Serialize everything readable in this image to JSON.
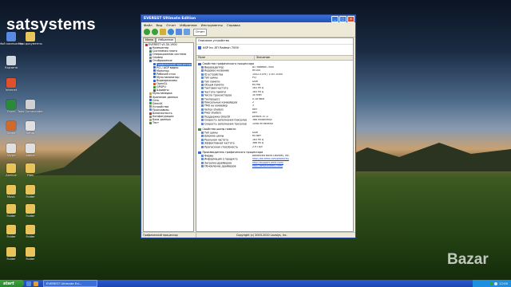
{
  "desktop": {
    "brand": "satsystems",
    "watermark": "Bazar",
    "icons": [
      {
        "label": "Мой компьютер",
        "color": "#5a8ae0"
      },
      {
        "label": "Мои документы",
        "color": "#e8c45a"
      },
      {
        "label": "Корзина",
        "color": "#cfd8e0"
      },
      {
        "label": "Internet",
        "color": "#e0502a"
      },
      {
        "label": "Excel",
        "color": "#2a8a3a"
      },
      {
        "label": "Total Commander",
        "color": "#d0d0d0"
      },
      {
        "label": "Game",
        "color": "#d06a2a"
      },
      {
        "label": "Setup",
        "color": "#e0e0e0"
      },
      {
        "label": "Skype",
        "color": "#e0e0e0"
      },
      {
        "label": "Adobe",
        "color": "#e0e0e0"
      },
      {
        "label": "Archive",
        "color": "#e8c45a"
      },
      {
        "label": "Files",
        "color": "#e8c45a"
      },
      {
        "label": "Music",
        "color": "#e8c45a"
      },
      {
        "label": "Folder",
        "color": "#e8c45a"
      },
      {
        "label": "Folder",
        "color": "#e8c45a"
      },
      {
        "label": "Folder",
        "color": "#e8c45a"
      },
      {
        "label": "Folder",
        "color": "#e8c45a"
      },
      {
        "label": "Folder",
        "color": "#e8c45a"
      },
      {
        "label": "Folder",
        "color": "#e8c45a"
      },
      {
        "label": "Folder",
        "color": "#e8c45a"
      }
    ]
  },
  "window": {
    "title": "EVEREST Ultimate Edition",
    "menu": [
      "Файл",
      "Вид",
      "Отчет",
      "Избранное",
      "Инструменты",
      "Справка"
    ],
    "report_button": "Отчет",
    "tabs": [
      "Меню",
      "Избранное"
    ],
    "tree": [
      {
        "label": "EVEREST v5.30.1900",
        "level": 0,
        "color": "#c03030"
      },
      {
        "label": "Компьютер",
        "level": 1,
        "color": "#5a8ae0"
      },
      {
        "label": "Системная плата",
        "level": 1,
        "color": "#3a9a3a"
      },
      {
        "label": "Операционная система",
        "level": 1,
        "color": "#5a8ae0"
      },
      {
        "label": "Сервер",
        "level": 1,
        "color": "#8a8a8a"
      },
      {
        "label": "Отображение",
        "level": 1,
        "color": "#3a6ad0"
      },
      {
        "label": "Графический процессор",
        "level": 2,
        "color": "#3a6ad0"
      },
      {
        "label": "PCI / AGP видео",
        "level": 2,
        "color": "#3a6ad0"
      },
      {
        "label": "Монитор",
        "level": 2,
        "color": "#3a6ad0"
      },
      {
        "label": "Рабочий стол",
        "level": 2,
        "color": "#3a6ad0"
      },
      {
        "label": "Мультимонитор",
        "level": 2,
        "color": "#3a6ad0"
      },
      {
        "label": "Видеорежимы",
        "level": 2,
        "color": "#3a6ad0"
      },
      {
        "label": "OpenGL",
        "level": 2,
        "color": "#d05a2a"
      },
      {
        "label": "GPGPU",
        "level": 2,
        "color": "#3a9a3a"
      },
      {
        "label": "Шрифты",
        "level": 2,
        "color": "#5a5a5a"
      },
      {
        "label": "Мультимедиа",
        "level": 1,
        "color": "#d0a02a"
      },
      {
        "label": "Хранение данных",
        "level": 1,
        "color": "#8a8a8a"
      },
      {
        "label": "Сеть",
        "level": 1,
        "color": "#3a6ad0"
      },
      {
        "label": "DirectX",
        "level": 1,
        "color": "#3a9a3a"
      },
      {
        "label": "Устройства",
        "level": 1,
        "color": "#8a8a8a"
      },
      {
        "label": "Программы",
        "level": 1,
        "color": "#5a8ae0"
      },
      {
        "label": "Безопасность",
        "level": 1,
        "color": "#c03030"
      },
      {
        "label": "Конфигурация",
        "level": 1,
        "color": "#8a8a8a"
      },
      {
        "label": "База данных",
        "level": 1,
        "color": "#d0a02a"
      },
      {
        "label": "Тест",
        "level": 1,
        "color": "#3a9a3a"
      }
    ],
    "tree_selected_index": 6,
    "device_header": "Описание устройства",
    "device_selected": "ASP Inc ATI Radeon 7000",
    "col_field": "Поле",
    "col_value": "Значение",
    "groups": [
      {
        "title": "Свойства графического процессора",
        "color": "#3a6ad0",
        "rows": [
          {
            "f": "Видеоадаптер",
            "v": "ATI Radeon 7000",
            "link": false
          },
          {
            "f": "Кодовое название",
            "v": "RV100",
            "link": false
          },
          {
            "f": "ID устройства",
            "v": "1002-5159 / 1787-0300",
            "link": false
          },
          {
            "f": "Тип шины",
            "v": "PCI",
            "link": false
          },
          {
            "f": "Тип памяти",
            "v": "DDR",
            "link": false
          },
          {
            "f": "Объем памяти",
            "v": "64 МБ",
            "link": false
          },
          {
            "f": "Тактовая частота",
            "v": "183 МГц",
            "link": false
          },
          {
            "f": "Частота памяти",
            "v": "183 МГц",
            "link": false
          },
          {
            "f": "Число транзисторов",
            "v": "30 млн",
            "link": false
          },
          {
            "f": "Техпроцесс",
            "v": "0.18 мкм",
            "link": false
          },
          {
            "f": "Пиксельных конвейеров",
            "v": "2",
            "link": false
          },
          {
            "f": "TMU на конвейер",
            "v": "3",
            "link": false
          },
          {
            "f": "Vertex shaders",
            "v": "Нет",
            "link": false
          },
          {
            "f": "Pixel shaders",
            "v": "Нет",
            "link": false
          },
          {
            "f": "Поддержка DirectX",
            "v": "DirectX v7.0",
            "link": false
          },
          {
            "f": "Скорость заполнения пикселов",
            "v": "366 МПиксел/с",
            "link": false
          },
          {
            "f": "Скорость заполнения текселов",
            "v": "1098 МТексел/с",
            "link": false
          }
        ]
      },
      {
        "title": "Свойства шины памяти",
        "color": "#3a9a3a",
        "rows": [
          {
            "f": "Тип шины",
            "v": "DDR",
            "link": false
          },
          {
            "f": "Ширина шины",
            "v": "64 бит",
            "link": false
          },
          {
            "f": "Реальная частота",
            "v": "183 МГц",
            "link": false
          },
          {
            "f": "Эффективная частота",
            "v": "366 МГц",
            "link": false
          },
          {
            "f": "Пропускная способность",
            "v": "2.9 ГБ/с",
            "link": false
          }
        ]
      },
      {
        "title": "Производитель графического процессора",
        "color": "#3a6ad0",
        "rows": [
          {
            "f": "Фирма",
            "v": "Advanced Micro Devices, Inc.",
            "link": false
          },
          {
            "f": "Информация о продукте",
            "v": "http://ati.amd.com/products/",
            "link": true
          },
          {
            "f": "Загрузка драйверов",
            "v": "http://support.amd.com/",
            "link": true
          },
          {
            "f": "Обновление драйверов",
            "v": "http://www.aida64.com/",
            "link": true
          }
        ]
      }
    ],
    "status_left": "Графический процессор",
    "status_right": "Copyright (c) 2003-2010 Lavalys, Inc."
  },
  "taskbar": {
    "start": "start",
    "task": "EVEREST Ultimate Ed...",
    "clock": "12:00"
  }
}
